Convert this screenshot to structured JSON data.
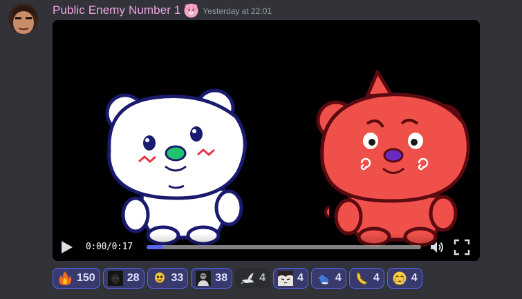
{
  "message": {
    "username": "Public Enemy Number 1",
    "role_icon": "pink-bear-face-icon",
    "timestamp": "Yesterday at 22:01"
  },
  "video": {
    "current_time": "0:00",
    "separator": "/",
    "duration": "0:17",
    "progress_fraction": 0.06,
    "accent_color": "#5865f2"
  },
  "reactions": [
    {
      "emoji": "fire-emoji",
      "count": "150",
      "reacted": true
    },
    {
      "emoji": "dark-portrait-emoji",
      "count": "28",
      "reacted": true
    },
    {
      "emoji": "yellow-blob-emoji",
      "count": "33",
      "reacted": true
    },
    {
      "emoji": "bw-portrait-emoji",
      "count": "38",
      "reacted": true
    },
    {
      "emoji": "dove-emoji",
      "count": "4",
      "reacted": false
    },
    {
      "emoji": "sad-anime-emoji",
      "count": "4",
      "reacted": true
    },
    {
      "emoji": "blue-bird-emoji",
      "count": "4",
      "reacted": true
    },
    {
      "emoji": "banana-emoji",
      "count": "4",
      "reacted": true
    },
    {
      "emoji": "crying-face-emoji",
      "count": "4",
      "reacted": true
    }
  ],
  "colors": {
    "background": "#313338",
    "username": "#f0a3e6",
    "timestamp": "#949ba4",
    "reaction_selected_bg": "#383a6e",
    "reaction_selected_border": "#5865f2"
  }
}
